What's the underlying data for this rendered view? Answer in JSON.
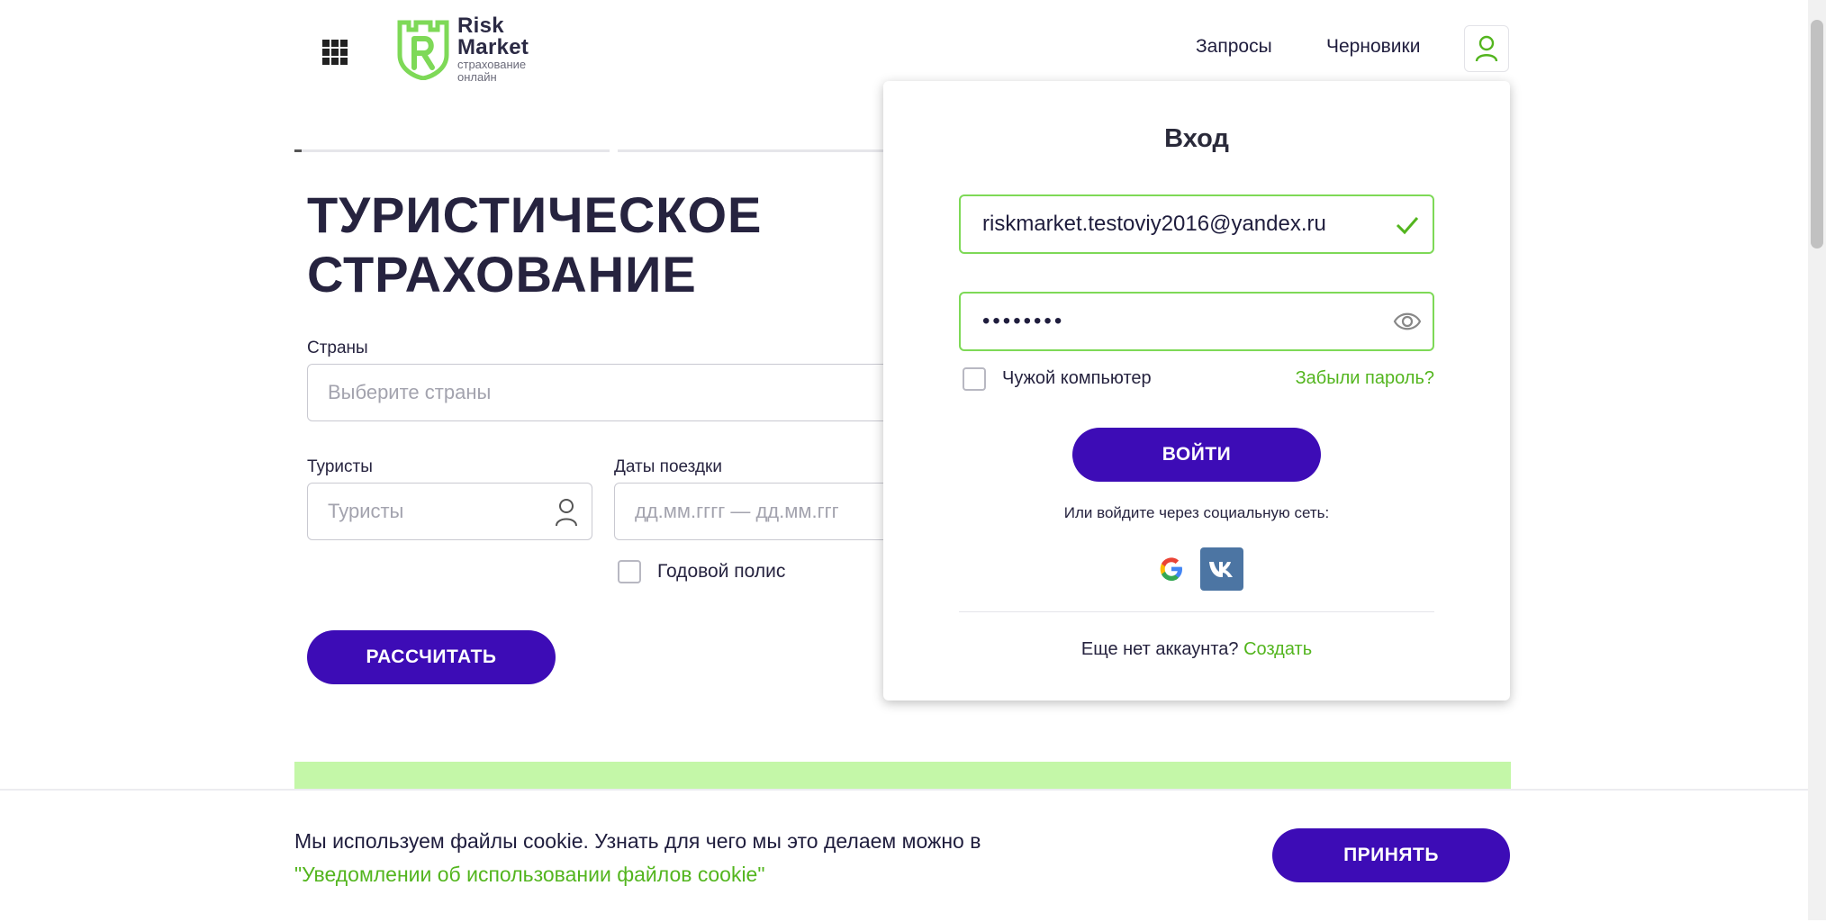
{
  "header": {
    "logo": {
      "line1": "Risk",
      "line2": "Market",
      "line3": "страхование",
      "line4": "онлайн"
    },
    "nav": [
      {
        "label": "Запросы"
      },
      {
        "label": "Черновики"
      }
    ]
  },
  "hero": {
    "title_line1": "ТУРИСТИЧЕСКОЕ",
    "title_line2": "СТРАХОВАНИЕ",
    "countries_label": "Страны",
    "countries_placeholder": "Выберите страны",
    "tourists_label": "Туристы",
    "tourists_placeholder": "Туристы",
    "dates_label": "Даты поездки",
    "dates_placeholder": "дд.мм.гггг — дд.мм.ггг",
    "annual_label": "Годовой полис",
    "calc_button": "РАССЧИТАТЬ"
  },
  "login": {
    "title": "Вход",
    "email_value": "riskmarket.testoviy2016@yandex.ru",
    "password_mask": "••••••••",
    "foreign_pc_label": "Чужой компьютер",
    "forgot_link": "Забыли пароль?",
    "submit_button": "ВОЙТИ",
    "social_text": "Или войдите через социальную сеть:",
    "no_account_text": "Еще нет аккаунта?",
    "create_link": "Создать"
  },
  "cookie": {
    "text": "Мы используем файлы cookie. Узнать для чего мы это делаем можно в",
    "link": "\"Уведомлении об использовании файлов cookie\"",
    "accept_button": "ПРИНЯТЬ"
  },
  "colors": {
    "brand_purple": "#3d0cb6",
    "accent_green": "#53b51e",
    "band_green": "#c4f7a8"
  },
  "icons": [
    "apps-grid-icon",
    "user-icon",
    "checkmark-icon",
    "eye-icon",
    "google-icon",
    "vk-icon"
  ]
}
